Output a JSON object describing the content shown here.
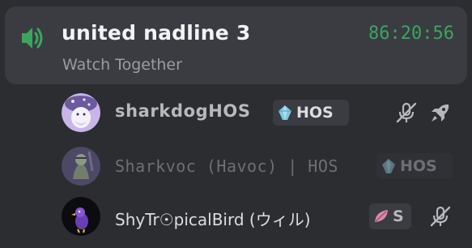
{
  "channel": {
    "name": "united nadline 3",
    "timer": "86:20:56",
    "activity": "Watch Together"
  },
  "users": [
    {
      "name": "sharkdogHOS",
      "tag": "HOS",
      "muted": true,
      "activity_icon": "rocket-icon"
    },
    {
      "name": "Sharkvoc (Havoc) | HOS",
      "tag": "HOS",
      "muted": false
    },
    {
      "name": "ShyTr☉picalBird (ウィル)",
      "tag": "S",
      "muted": true
    }
  ],
  "colors": {
    "background": "#2b2d31",
    "card": "#3a3c42",
    "timer_green": "#3ba55d",
    "speaker_green": "#3ba55d"
  }
}
